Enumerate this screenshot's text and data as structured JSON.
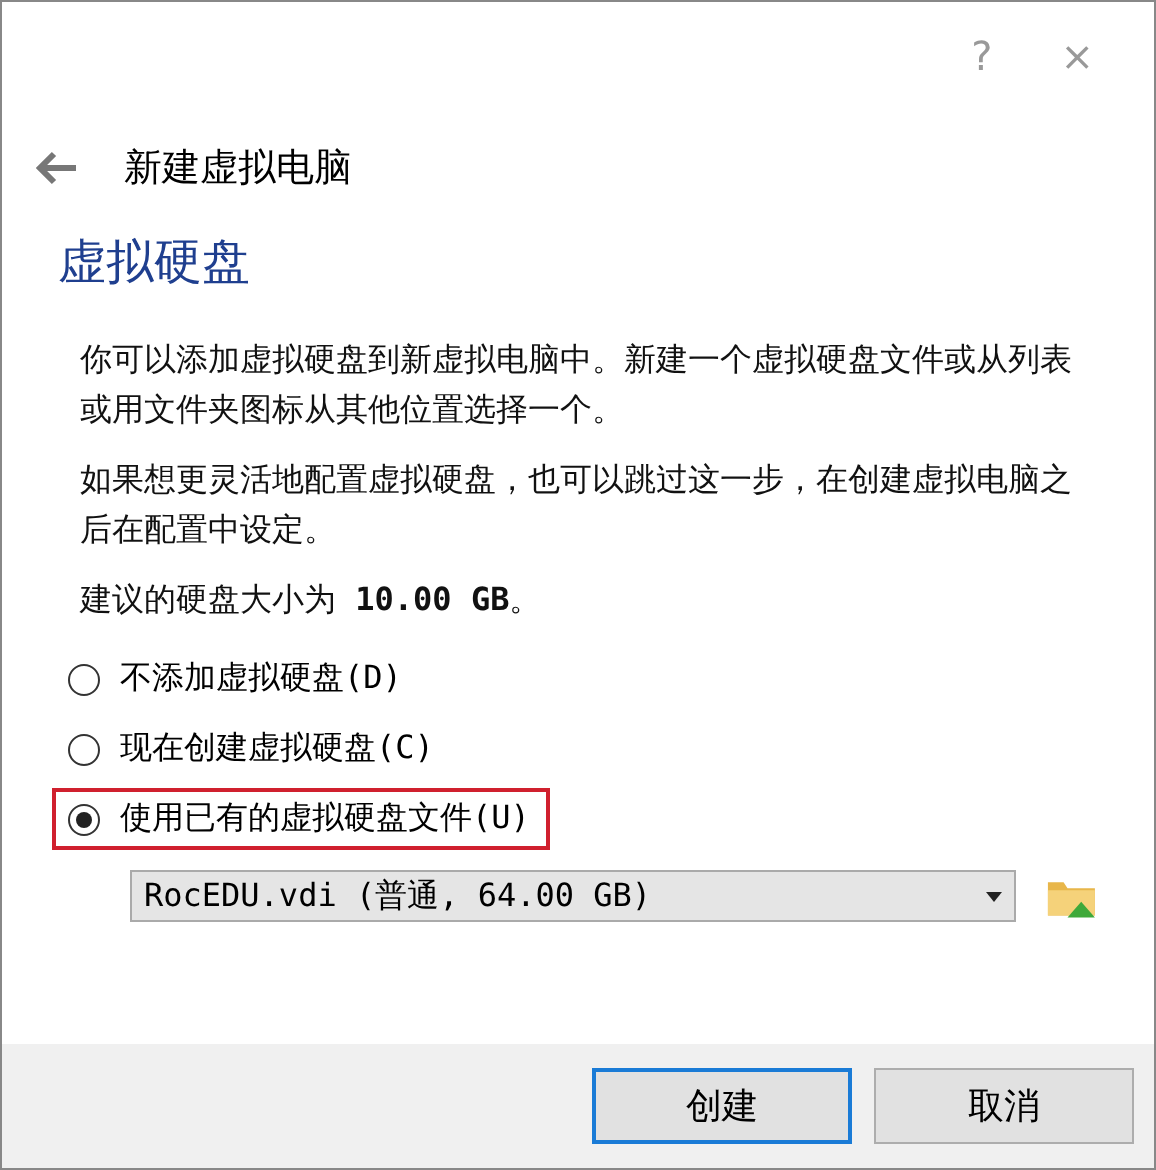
{
  "window": {
    "help": "?",
    "close": "×"
  },
  "header": {
    "title": "新建虚拟电脑"
  },
  "heading": "虚拟硬盘",
  "paragraphs": [
    "你可以添加虚拟硬盘到新虚拟电脑中。新建一个虚拟硬盘文件或从列表或用文件夹图标从其他位置选择一个。",
    "如果想更灵活地配置虚拟硬盘，也可以跳过这一步，在创建虚拟电脑之后在配置中设定。",
    "建议的硬盘大小为 **10.00 GB**。"
  ],
  "options": [
    {
      "label": "不添加虚拟硬盘(D)",
      "selected": false,
      "highlighted": false
    },
    {
      "label": "现在创建虚拟硬盘(C)",
      "selected": false,
      "highlighted": false
    },
    {
      "label": "使用已有的虚拟硬盘文件(U)",
      "selected": true,
      "highlighted": true
    }
  ],
  "disk_select": {
    "value": "RocEDU.vdi (普通, 64.00 GB)"
  },
  "buttons": [
    {
      "label": "创建",
      "default": true
    },
    {
      "label": "取消",
      "default": false
    }
  ]
}
